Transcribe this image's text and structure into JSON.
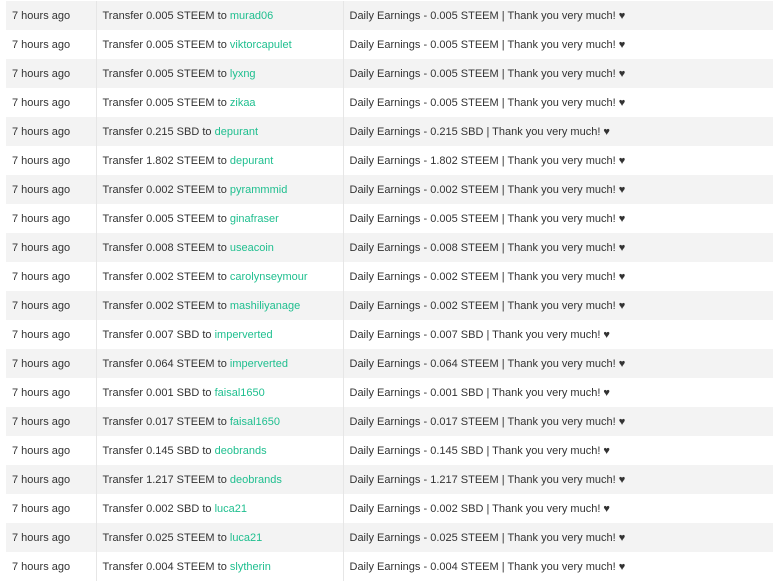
{
  "link_color": "#1fbf8f",
  "transfers": [
    {
      "time": "7 hours ago",
      "action": "Transfer 0.005 STEEM to ",
      "account": "murad06",
      "memo": "Daily Earnings - 0.005 STEEM | Thank you very much! ♥"
    },
    {
      "time": "7 hours ago",
      "action": "Transfer 0.005 STEEM to ",
      "account": "viktorcapulet",
      "memo": "Daily Earnings - 0.005 STEEM | Thank you very much! ♥"
    },
    {
      "time": "7 hours ago",
      "action": "Transfer 0.005 STEEM to ",
      "account": "lyxng",
      "memo": "Daily Earnings - 0.005 STEEM | Thank you very much! ♥"
    },
    {
      "time": "7 hours ago",
      "action": "Transfer 0.005 STEEM to ",
      "account": "zikaa",
      "memo": "Daily Earnings - 0.005 STEEM | Thank you very much! ♥"
    },
    {
      "time": "7 hours ago",
      "action": "Transfer 0.215 SBD to ",
      "account": "depurant",
      "memo": "Daily Earnings - 0.215 SBD | Thank you very much! ♥"
    },
    {
      "time": "7 hours ago",
      "action": "Transfer 1.802 STEEM to ",
      "account": "depurant",
      "memo": "Daily Earnings - 1.802 STEEM | Thank you very much! ♥"
    },
    {
      "time": "7 hours ago",
      "action": "Transfer 0.002 STEEM to ",
      "account": "pyrammmid",
      "memo": "Daily Earnings - 0.002 STEEM | Thank you very much! ♥"
    },
    {
      "time": "7 hours ago",
      "action": "Transfer 0.005 STEEM to ",
      "account": "ginafraser",
      "memo": "Daily Earnings - 0.005 STEEM | Thank you very much! ♥"
    },
    {
      "time": "7 hours ago",
      "action": "Transfer 0.008 STEEM to ",
      "account": "useacoin",
      "memo": "Daily Earnings - 0.008 STEEM | Thank you very much! ♥"
    },
    {
      "time": "7 hours ago",
      "action": "Transfer 0.002 STEEM to ",
      "account": "carolynseymour",
      "memo": "Daily Earnings - 0.002 STEEM | Thank you very much! ♥"
    },
    {
      "time": "7 hours ago",
      "action": "Transfer 0.002 STEEM to ",
      "account": "mashiliyanage",
      "memo": "Daily Earnings - 0.002 STEEM | Thank you very much! ♥"
    },
    {
      "time": "7 hours ago",
      "action": "Transfer 0.007 SBD to ",
      "account": "imperverted",
      "memo": "Daily Earnings - 0.007 SBD | Thank you very much! ♥"
    },
    {
      "time": "7 hours ago",
      "action": "Transfer 0.064 STEEM to ",
      "account": "imperverted",
      "memo": "Daily Earnings - 0.064 STEEM | Thank you very much! ♥"
    },
    {
      "time": "7 hours ago",
      "action": "Transfer 0.001 SBD to ",
      "account": "faisal1650",
      "memo": "Daily Earnings - 0.001 SBD | Thank you very much! ♥"
    },
    {
      "time": "7 hours ago",
      "action": "Transfer 0.017 STEEM to ",
      "account": "faisal1650",
      "memo": "Daily Earnings - 0.017 STEEM | Thank you very much! ♥"
    },
    {
      "time": "7 hours ago",
      "action": "Transfer 0.145 SBD to ",
      "account": "deobrands",
      "memo": "Daily Earnings - 0.145 SBD | Thank you very much! ♥"
    },
    {
      "time": "7 hours ago",
      "action": "Transfer 1.217 STEEM to ",
      "account": "deobrands",
      "memo": "Daily Earnings - 1.217 STEEM | Thank you very much! ♥"
    },
    {
      "time": "7 hours ago",
      "action": "Transfer 0.002 SBD to ",
      "account": "luca21",
      "memo": "Daily Earnings - 0.002 SBD | Thank you very much! ♥"
    },
    {
      "time": "7 hours ago",
      "action": "Transfer 0.025 STEEM to ",
      "account": "luca21",
      "memo": "Daily Earnings - 0.025 STEEM | Thank you very much! ♥"
    },
    {
      "time": "7 hours ago",
      "action": "Transfer 0.004 STEEM to ",
      "account": "slytherin",
      "memo": "Daily Earnings - 0.004 STEEM | Thank you very much! ♥"
    }
  ]
}
